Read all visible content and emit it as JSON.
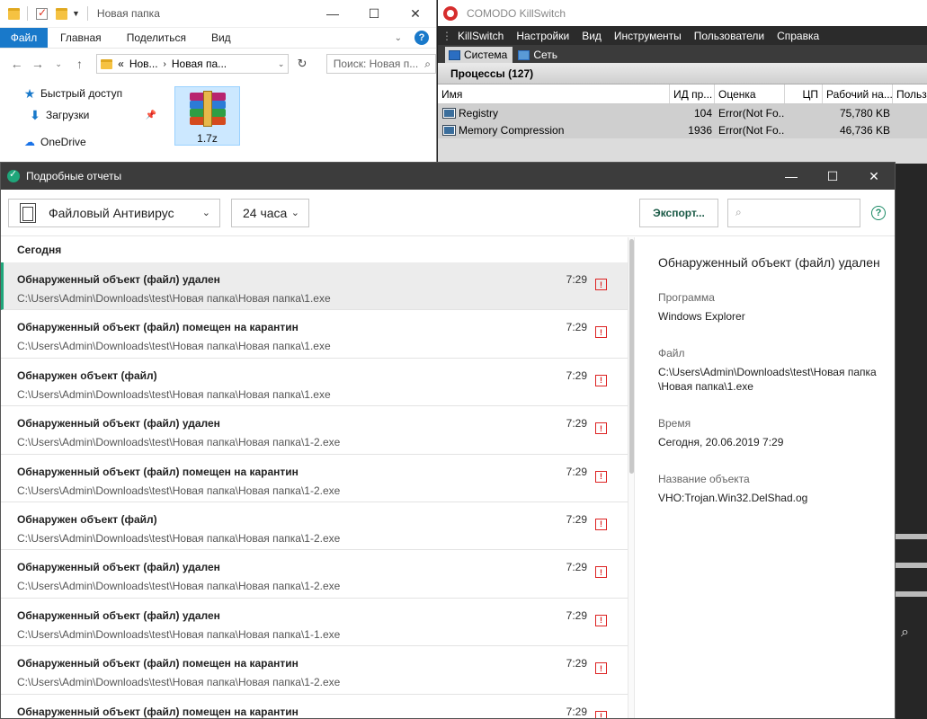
{
  "explorer": {
    "title": "Новая папка",
    "ribbon": {
      "file": "Файл",
      "home": "Главная",
      "share": "Поделиться",
      "view": "Вид"
    },
    "address": {
      "prefix": "«",
      "crumb1": "Нов...",
      "crumb2": "Новая па..."
    },
    "search_placeholder": "Поиск: Новая п...",
    "nav": [
      {
        "label": "Быстрый доступ"
      },
      {
        "label": "Загрузки"
      },
      {
        "label": "OneDrive"
      }
    ],
    "file": {
      "name": "1.7z"
    }
  },
  "killswitch": {
    "title": "COMODO KillSwitch",
    "menu": [
      "KillSwitch",
      "Настройки",
      "Вид",
      "Инструменты",
      "Пользователи",
      "Справка"
    ],
    "tabs": [
      "Система",
      "Сеть"
    ],
    "processes_header": "Процессы (127)",
    "columns": [
      "Имя",
      "ИД пр...",
      "Оценка",
      "ЦП",
      "Рабочий на...",
      "Польз"
    ],
    "rows": [
      {
        "name": "Registry",
        "pid": "104",
        "rating": "Error(Not Fo...",
        "cpu": "",
        "ws": "75,780 KB"
      },
      {
        "name": "Memory Compression",
        "pid": "1936",
        "rating": "Error(Not Fo...",
        "cpu": "",
        "ws": "46,736 KB"
      }
    ]
  },
  "reports": {
    "title": "Подробные отчеты",
    "filter_component": "Файловый Антивирус",
    "filter_period": "24 часа",
    "export_label": "Экспорт...",
    "group_label": "Сегодня",
    "items": [
      {
        "title": "Обнаруженный объект (файл) удален",
        "path": "C:\\Users\\Admin\\Downloads\\test\\Новая папка\\Новая папка\\1.exe",
        "time": "7:29"
      },
      {
        "title": "Обнаруженный объект (файл) помещен на карантин",
        "path": "C:\\Users\\Admin\\Downloads\\test\\Новая папка\\Новая папка\\1.exe",
        "time": "7:29"
      },
      {
        "title": "Обнаружен объект (файл)",
        "path": "C:\\Users\\Admin\\Downloads\\test\\Новая папка\\Новая папка\\1.exe",
        "time": "7:29"
      },
      {
        "title": "Обнаруженный объект (файл) удален",
        "path": "C:\\Users\\Admin\\Downloads\\test\\Новая папка\\Новая папка\\1-2.exe",
        "time": "7:29"
      },
      {
        "title": "Обнаруженный объект (файл) помещен на карантин",
        "path": "C:\\Users\\Admin\\Downloads\\test\\Новая папка\\Новая папка\\1-2.exe",
        "time": "7:29"
      },
      {
        "title": "Обнаружен объект (файл)",
        "path": "C:\\Users\\Admin\\Downloads\\test\\Новая папка\\Новая папка\\1-2.exe",
        "time": "7:29"
      },
      {
        "title": "Обнаруженный объект (файл) удален",
        "path": "C:\\Users\\Admin\\Downloads\\test\\Новая папка\\Новая папка\\1-2.exe",
        "time": "7:29"
      },
      {
        "title": "Обнаруженный объект (файл) удален",
        "path": "C:\\Users\\Admin\\Downloads\\test\\Новая папка\\Новая папка\\1-1.exe",
        "time": "7:29"
      },
      {
        "title": "Обнаруженный объект (файл) помещен на карантин",
        "path": "C:\\Users\\Admin\\Downloads\\test\\Новая папка\\Новая папка\\1-2.exe",
        "time": "7:29"
      },
      {
        "title": "Обнаруженный объект (файл) помещен на карантин",
        "path": "",
        "time": "7:29"
      }
    ],
    "detail": {
      "title": "Обнаруженный объект (файл) удален",
      "program_label": "Программа",
      "program_value": "Windows Explorer",
      "file_label": "Файл",
      "file_value": "C:\\Users\\Admin\\Downloads\\test\\Новая папка\n\\Новая папка\\1.exe",
      "time_label": "Время",
      "time_value": "Сегодня, 20.06.2019 7:29",
      "object_label": "Название объекта",
      "object_value": "VHO:Trojan.Win32.DelShad.og"
    }
  }
}
